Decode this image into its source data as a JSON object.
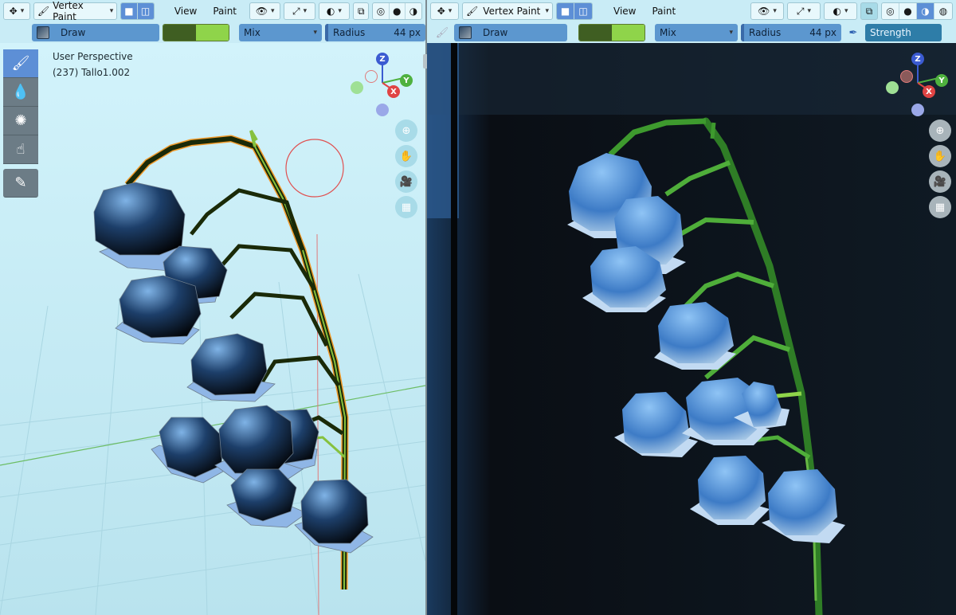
{
  "left": {
    "editor_type_icon": "viewport-editor-icon",
    "mode": "Vertex Paint",
    "menus": [
      "View",
      "Paint"
    ],
    "brush_name": "Draw",
    "blend": "Mix",
    "radius_label": "Radius",
    "radius_value": "44 px",
    "viewport_title": "User Perspective",
    "object_info": "(237) Tallo1.002",
    "gizmo": {
      "z": "Z",
      "y": "Y",
      "x": "X"
    },
    "primary_color": "#3f5e22",
    "secondary_color": "#8fd44a"
  },
  "right": {
    "mode": "Vertex Paint",
    "menus": [
      "View",
      "Paint"
    ],
    "brush_name": "Draw",
    "blend": "Mix",
    "radius_label": "Radius",
    "radius_value": "44 px",
    "strength_label": "Strength",
    "gizmo": {
      "z": "Z",
      "y": "Y",
      "x": "X"
    }
  }
}
